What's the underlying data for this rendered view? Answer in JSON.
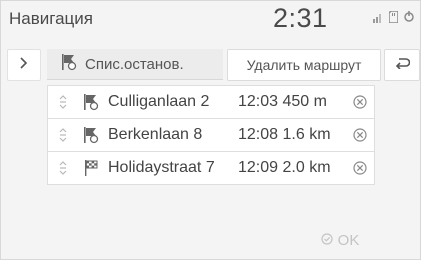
{
  "header": {
    "title": "Навигация",
    "time": "2:31",
    "icons": [
      "signal-icon",
      "sd-card-icon",
      "power-icon"
    ]
  },
  "side_button": {
    "icon": "chevron-right-icon",
    "label": ">"
  },
  "list_header": {
    "icon": "flag-list-icon",
    "label": "Спис.останов."
  },
  "actions": {
    "delete_route": "Удалить маршрут",
    "back_icon": "back-arrow-icon",
    "ok": "OK"
  },
  "stops": [
    {
      "name": "Culliganlaan 2",
      "arrival": "12:03",
      "distance": "450 m",
      "icon": "waypoint-flag-icon",
      "drag_icon": "drag-handle-icon",
      "remove_icon": "remove-x-icon"
    },
    {
      "name": "Berkenlaan 8",
      "arrival": "12:08",
      "distance": "1.6 km",
      "icon": "waypoint-flag-icon",
      "drag_icon": "drag-handle-icon",
      "remove_icon": "remove-x-icon"
    },
    {
      "name": "Holidaystraat 7",
      "arrival": "12:09",
      "distance": "2.0 km",
      "icon": "destination-flag-icon",
      "drag_icon": "drag-handle-icon",
      "remove_icon": "remove-x-icon"
    }
  ],
  "colors": {
    "background": "#f4f4f4",
    "row_background": "#ffffff",
    "text": "#444444",
    "disabled_text": "#c4c4c4"
  }
}
